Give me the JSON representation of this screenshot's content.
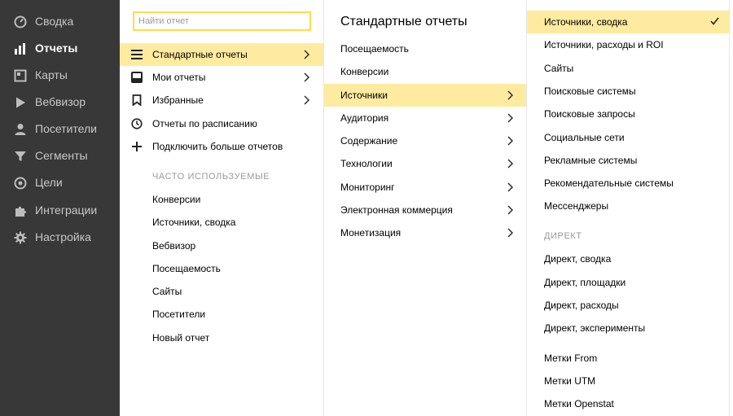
{
  "sidebar": {
    "items": [
      {
        "label": "Сводка",
        "icon": "dashboard-icon"
      },
      {
        "label": "Отчеты",
        "icon": "bar-chart-icon",
        "active": true
      },
      {
        "label": "Карты",
        "icon": "map-icon"
      },
      {
        "label": "Вебвизор",
        "icon": "play-icon"
      },
      {
        "label": "Посетители",
        "icon": "user-icon"
      },
      {
        "label": "Сегменты",
        "icon": "filter-icon"
      },
      {
        "label": "Цели",
        "icon": "target-icon"
      },
      {
        "label": "Интеграции",
        "icon": "puzzle-icon"
      },
      {
        "label": "Настройка",
        "icon": "gear-icon"
      }
    ]
  },
  "reports_menu": {
    "search_placeholder": "Найти отчет",
    "items": [
      {
        "label": "Стандартные отчеты",
        "icon": "list-icon",
        "has_submenu": true,
        "highlighted": true
      },
      {
        "label": "Мои отчеты",
        "icon": "inbox-icon",
        "has_submenu": true
      },
      {
        "label": "Избранные",
        "icon": "bookmark-icon",
        "has_submenu": true
      },
      {
        "label": "Отчеты по расписанию",
        "icon": "clock-icon"
      },
      {
        "label": "Подключить больше отчетов",
        "icon": "plus-icon"
      }
    ],
    "frequent_heading": "ЧАСТО ИСПОЛЬЗУЕМЫЕ",
    "frequent": [
      "Конверсии",
      "Источники, сводка",
      "Вебвизор",
      "Посещаемость",
      "Сайты",
      "Посетители",
      "Новый отчет"
    ]
  },
  "standard_reports": {
    "title": "Стандартные отчеты",
    "items": [
      {
        "label": "Посещаемость",
        "has_submenu": false
      },
      {
        "label": "Конверсии",
        "has_submenu": false
      },
      {
        "label": "Источники",
        "has_submenu": true,
        "highlighted": true
      },
      {
        "label": "Аудитория",
        "has_submenu": true
      },
      {
        "label": "Содержание",
        "has_submenu": true
      },
      {
        "label": "Технологии",
        "has_submenu": true
      },
      {
        "label": "Мониторинг",
        "has_submenu": true
      },
      {
        "label": "Электронная коммерция",
        "has_submenu": true
      },
      {
        "label": "Монетизация",
        "has_submenu": true
      }
    ]
  },
  "sources": {
    "selected": "Источники, сводка",
    "items": [
      "Источники, расходы и ROI",
      "Сайты",
      "Поисковые системы",
      "Поисковые запросы",
      "Социальные сети",
      "Рекламные системы",
      "Рекомендательные системы",
      "Мессенджеры"
    ],
    "direct_heading": "ДИРЕКТ",
    "direct_items": [
      "Директ, сводка",
      "Директ, площадки",
      "Директ, расходы",
      "Директ, эксперименты"
    ],
    "tag_items": [
      "Метки From",
      "Метки UTM",
      "Метки Openstat"
    ]
  },
  "colors": {
    "sidebar_bg": "#383838",
    "highlight": "#ffeba0",
    "search_border": "#ffdb4d"
  }
}
